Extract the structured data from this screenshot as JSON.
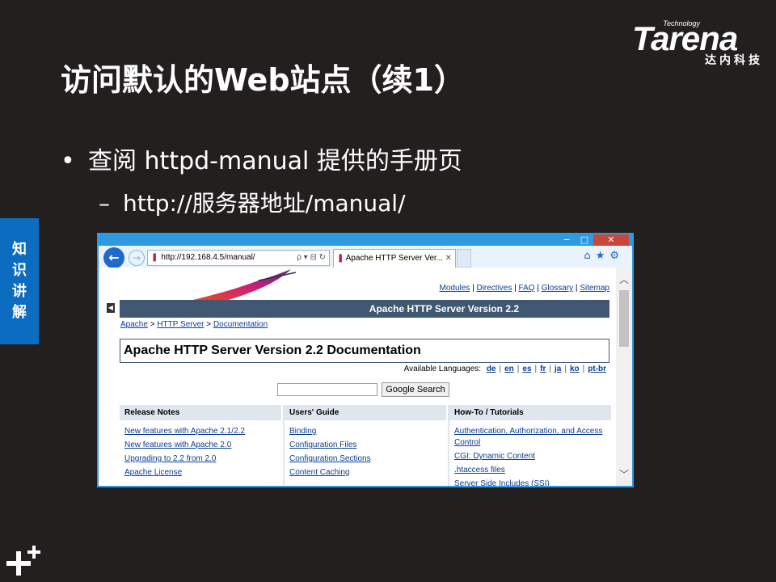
{
  "logo": {
    "tech": "Technology",
    "word": "Tarena",
    "cn": "达内科技"
  },
  "slide": {
    "title": "访问默认的Web站点（续1）",
    "bullet1": {
      "marker": "•",
      "text": "查阅 httpd-manual 提供的手册页"
    },
    "bullet2": {
      "marker": "–",
      "text": "http://服务器地址/manual/"
    },
    "side_tab": [
      "知",
      "识",
      "讲",
      "解"
    ]
  },
  "browser": {
    "window_controls": {
      "minimize": "−",
      "maximize": "□",
      "close": "✕"
    },
    "address": {
      "url": "http://192.168.4.5/manual/",
      "tools": "ρ ▾ ⊟ ↻"
    },
    "tab": {
      "label": "Apache HTTP Server Ver...",
      "close": "✕"
    },
    "nav_icons": {
      "home": "⌂",
      "star": "★",
      "gear": "⚙"
    },
    "page": {
      "top_links": [
        "Modules",
        "Directives",
        "FAQ",
        "Glossary",
        "Sitemap"
      ],
      "banner": "Apache HTTP Server Version 2.2",
      "breadcrumb": [
        "Apache",
        "HTTP Server",
        "Documentation"
      ],
      "doc_title": "Apache HTTP Server Version 2.2 Documentation",
      "languages_label": "Available Languages:",
      "languages": [
        "de",
        "en",
        "es",
        "fr",
        "ja",
        "ko",
        "pt-br"
      ],
      "search_button": "Google Search",
      "columns": [
        {
          "heading": "Release Notes",
          "items": [
            "New features with Apache 2.1/2.2",
            "New features with Apache 2.0",
            "Upgrading to 2.2 from 2.0",
            "Apache License"
          ]
        },
        {
          "heading": "Users' Guide",
          "items": [
            "Binding",
            "Configuration Files",
            "Configuration Sections",
            "Content Caching"
          ]
        },
        {
          "heading": "How-To / Tutorials",
          "items": [
            "Authentication, Authorization, and Access Control",
            "CGI: Dynamic Content",
            ".htaccess files",
            "Server Side Includes (SSI)"
          ]
        }
      ]
    }
  },
  "colors": {
    "background": "#231f1f",
    "side_tab": "#0b6cc0",
    "browser_frame": "#2f9ae0",
    "banner": "#405871",
    "link": "#0b3d91"
  }
}
